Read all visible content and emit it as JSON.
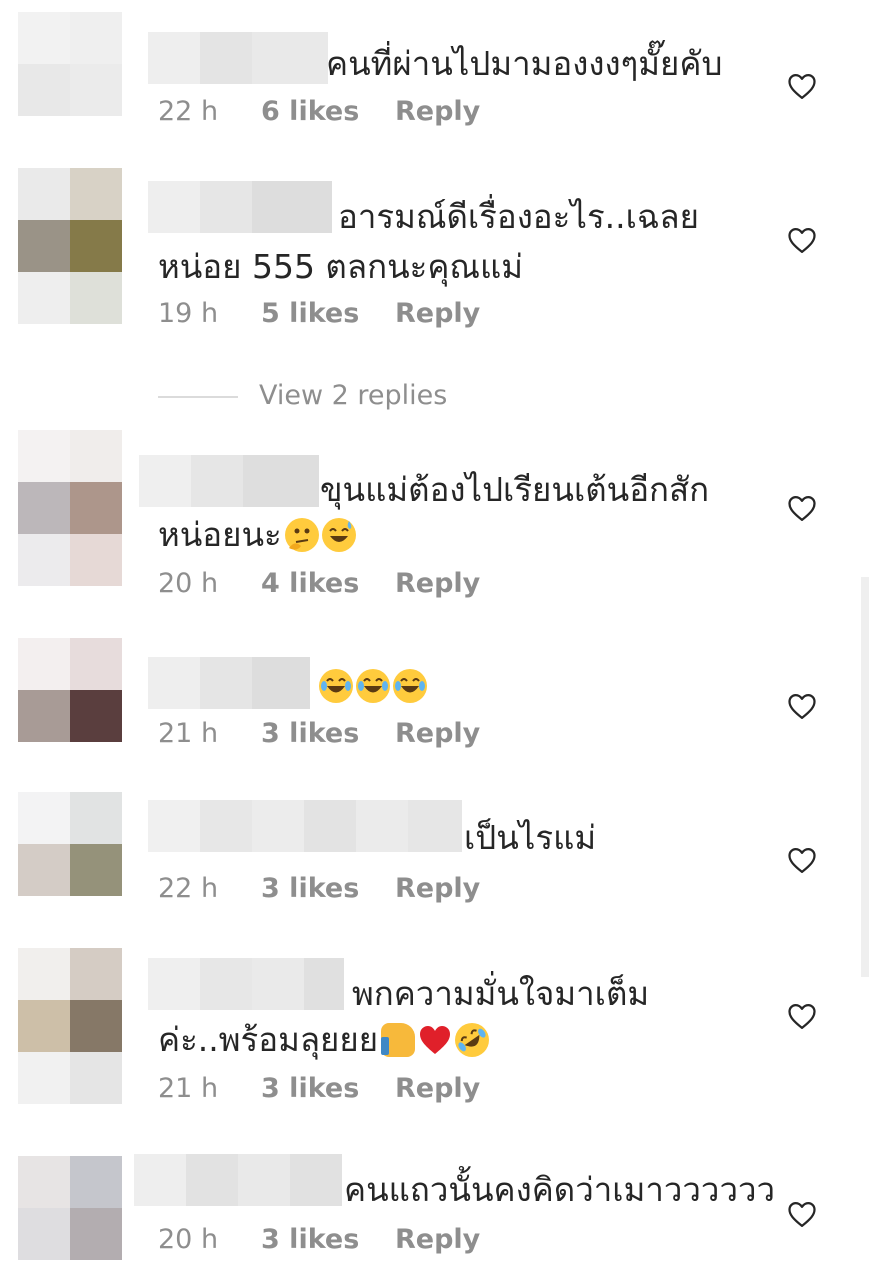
{
  "comments": [
    {
      "text1": "คนที่ผ่านไปมามองงงๆมั๊ยคับ",
      "text2": "",
      "emojis": [],
      "time": "22 h",
      "likes": "6 likes",
      "reply": "Reply"
    },
    {
      "text1": "อารมณ์ดีเรื่องอะไร..เฉลย",
      "text2": "หน่อย 555 ตลกนะคุณแม่",
      "emojis": [],
      "time": "19 h",
      "likes": "5 likes",
      "reply": "Reply"
    },
    {
      "text1": "ขุนแม่ต้องไปเรียนเต้นอีกสัก",
      "text2": "หน่อยนะ",
      "emojis": [
        "thinking-face",
        "grinning-sweat-face"
      ],
      "time": "20 h",
      "likes": "4 likes",
      "reply": "Reply"
    },
    {
      "text1": "",
      "text2": "",
      "emojis": [
        "tears-of-joy-face",
        "tears-of-joy-face",
        "tears-of-joy-face"
      ],
      "time": "21 h",
      "likes": "3 likes",
      "reply": "Reply"
    },
    {
      "text1": "เป็นไรแม่",
      "text2": "",
      "emojis": [],
      "time": "22 h",
      "likes": "3 likes",
      "reply": "Reply"
    },
    {
      "text1": "พกความมั่นใจมาเต็ม",
      "text2": "ค่ะ..พร้อมลุยยย",
      "emojis": [
        "thumbs-up",
        "red-heart",
        "rolling-laughing-face"
      ],
      "time": "21 h",
      "likes": "3 likes",
      "reply": "Reply"
    },
    {
      "text1": "คนแถวนั้นคงคิดว่าเมาวววววว",
      "text2": "",
      "emojis": [],
      "time": "20 h",
      "likes": "3 likes",
      "reply": "Reply"
    }
  ],
  "view_replies": "View 2 replies",
  "icons": {
    "like": "heart-outline-icon"
  },
  "colors": {
    "text": "#262626",
    "meta": "#8e8e8e",
    "divider": "#dbdbdb"
  }
}
